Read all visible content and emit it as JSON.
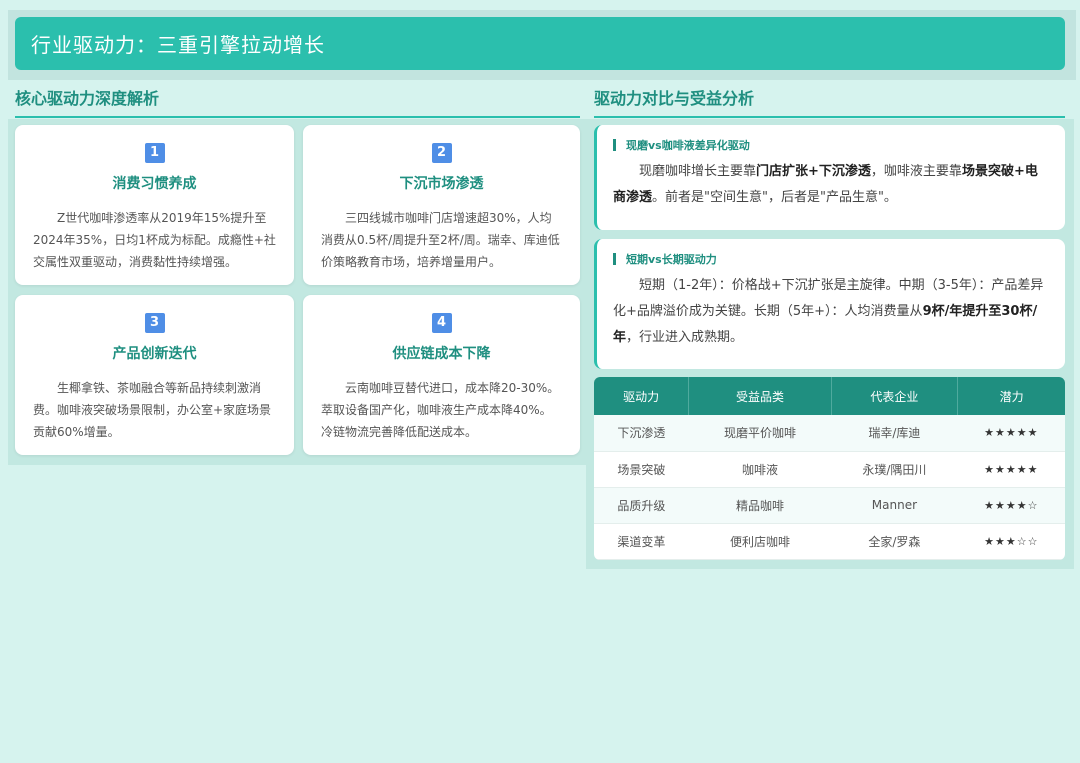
{
  "header": {
    "title": "行业驱动力：三重引擎拉动增长"
  },
  "left": {
    "section_title": "核心驱动力深度解析",
    "cards": [
      {
        "num": "1",
        "title": "消费习惯养成",
        "body": "Z世代咖啡渗透率从2019年15%提升至2024年35%，日均1杯成为标配。成瘾性+社交属性双重驱动，消费黏性持续增强。"
      },
      {
        "num": "2",
        "title": "下沉市场渗透",
        "body": "三四线城市咖啡门店增速超30%，人均消费从0.5杯/周提升至2杯/周。瑞幸、库迪低价策略教育市场，培养增量用户。"
      },
      {
        "num": "3",
        "title": "产品创新迭代",
        "body": "生椰拿铁、茶咖融合等新品持续刺激消费。咖啡液突破场景限制，办公室+家庭场景贡献60%增量。"
      },
      {
        "num": "4",
        "title": "供应链成本下降",
        "body": "云南咖啡豆替代进口，成本降20-30%。萃取设备国产化，咖啡液生产成本降40%。冷链物流完善降低配送成本。"
      }
    ]
  },
  "right": {
    "section_title": "驱动力对比与受益分析",
    "info1": {
      "title": "现磨vs咖啡液差异化驱动",
      "p1": "现磨咖啡增长主要靠",
      "b1": "门店扩张+下沉渗透",
      "p2": "，咖啡液主要靠",
      "b2": "场景突破+电商渗透",
      "p3": "。前者是\"空间生意\"，后者是\"产品生意\"。"
    },
    "info2": {
      "title": "短期vs长期驱动力",
      "p1": "短期（1-2年）：价格战+下沉扩张是主旋律。中期（3-5年）：产品差异化+品牌溢价成为关键。长期（5年+）：人均消费量从",
      "b1": "9杯/年提升至30杯/年",
      "p2": "，行业进入成熟期。"
    },
    "table": {
      "headers": [
        "驱动力",
        "受益品类",
        "代表企业",
        "潜力"
      ],
      "rows": [
        [
          "下沉渗透",
          "现磨平价咖啡",
          "瑞幸/库迪",
          "★★★★★"
        ],
        [
          "场景突破",
          "咖啡液",
          "永璞/隅田川",
          "★★★★★"
        ],
        [
          "品质升级",
          "精品咖啡",
          "Manner",
          "★★★★☆"
        ],
        [
          "渠道变革",
          "便利店咖啡",
          "全家/罗森",
          "★★★☆☆"
        ]
      ]
    }
  }
}
